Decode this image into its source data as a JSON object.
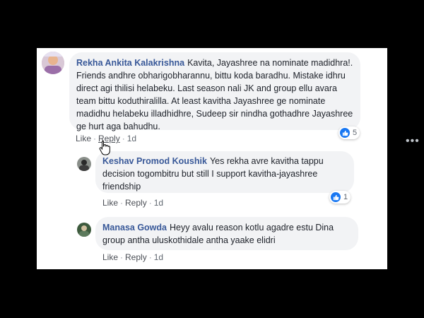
{
  "comments": [
    {
      "author": "Rekha Ankita Kalakrishna",
      "text": "Kavita, Jayashree na nominate madidhra!. Friends andhre obharigobharannu, bittu koda baradhu. Mistake idhru direct agi thilisi helabeku. Last season nali JK and group ellu avara team bittu koduthiralilla. At least kavitha Jayashree ge nominate madidhu helabeku illadhidhre, Sudeep sir nindha gothadhre Jayashree ge hurt aga bahudhu.",
      "like_label": "Like",
      "reply_label": "Reply",
      "time": "1d",
      "reactions": "5"
    },
    {
      "author": "Keshav Promod Koushik",
      "text": "Yes rekha avre kavitha tappu decision togombitru but still I support kavitha-jayashree friendship",
      "like_label": "Like",
      "reply_label": "Reply",
      "time": "1d",
      "reactions": "1"
    },
    {
      "author": "Manasa Gowda",
      "text": "Heyy avalu reason kotlu agadre estu Dina group antha uluskothidale antha yaake elidri",
      "like_label": "Like",
      "reply_label": "Reply",
      "time": "1d"
    }
  ],
  "separator": "·",
  "more_icon": "more-options-icon",
  "colors": {
    "author": "#385898",
    "bubble": "#f2f3f5",
    "like": "#1877f2"
  }
}
